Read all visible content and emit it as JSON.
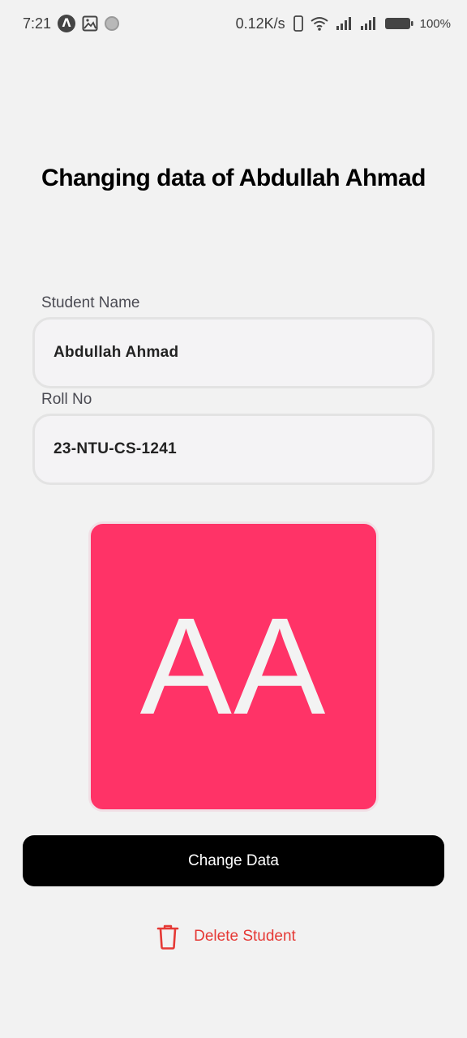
{
  "status_bar": {
    "time": "7:21",
    "net_speed": "0.12K/s",
    "battery": "100%"
  },
  "page": {
    "title": "Changing data of Abdullah Ahmad"
  },
  "form": {
    "name_label": "Student Name",
    "name_value": "Abdullah Ahmad",
    "roll_label": "Roll No",
    "roll_value": "23-NTU-CS-1241"
  },
  "avatar": {
    "initials": "AA",
    "color": "#ff3367"
  },
  "actions": {
    "change_label": "Change Data",
    "delete_label": "Delete Student",
    "delete_color": "#e53935"
  }
}
